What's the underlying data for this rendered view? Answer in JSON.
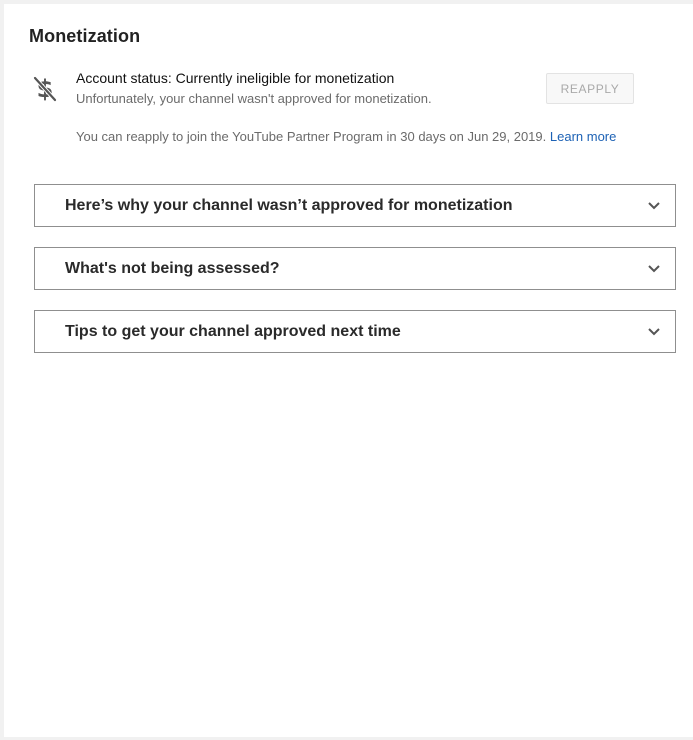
{
  "section": {
    "title": "Monetization"
  },
  "account_status": {
    "heading": "Account status: Currently ineligible for monetization",
    "subtext": "Unfortunately, your channel wasn't approved for monetization.",
    "icon": "no-money-icon",
    "reapply_label": "REAPPLY",
    "reapply_note": "You can reapply to join the YouTube Partner Program in 30 days on Jun 29, 2019.",
    "learn_more": "Learn more"
  },
  "accordions": [
    {
      "label": "Here’s why your channel wasn’t approved for monetization"
    },
    {
      "label": "What's not being assessed?"
    },
    {
      "label": "Tips to get your channel approved next time"
    }
  ],
  "colors": {
    "link": "#1d62b5",
    "muted_text": "#6b6b6b",
    "disabled_button_text": "#a9a9a9"
  }
}
